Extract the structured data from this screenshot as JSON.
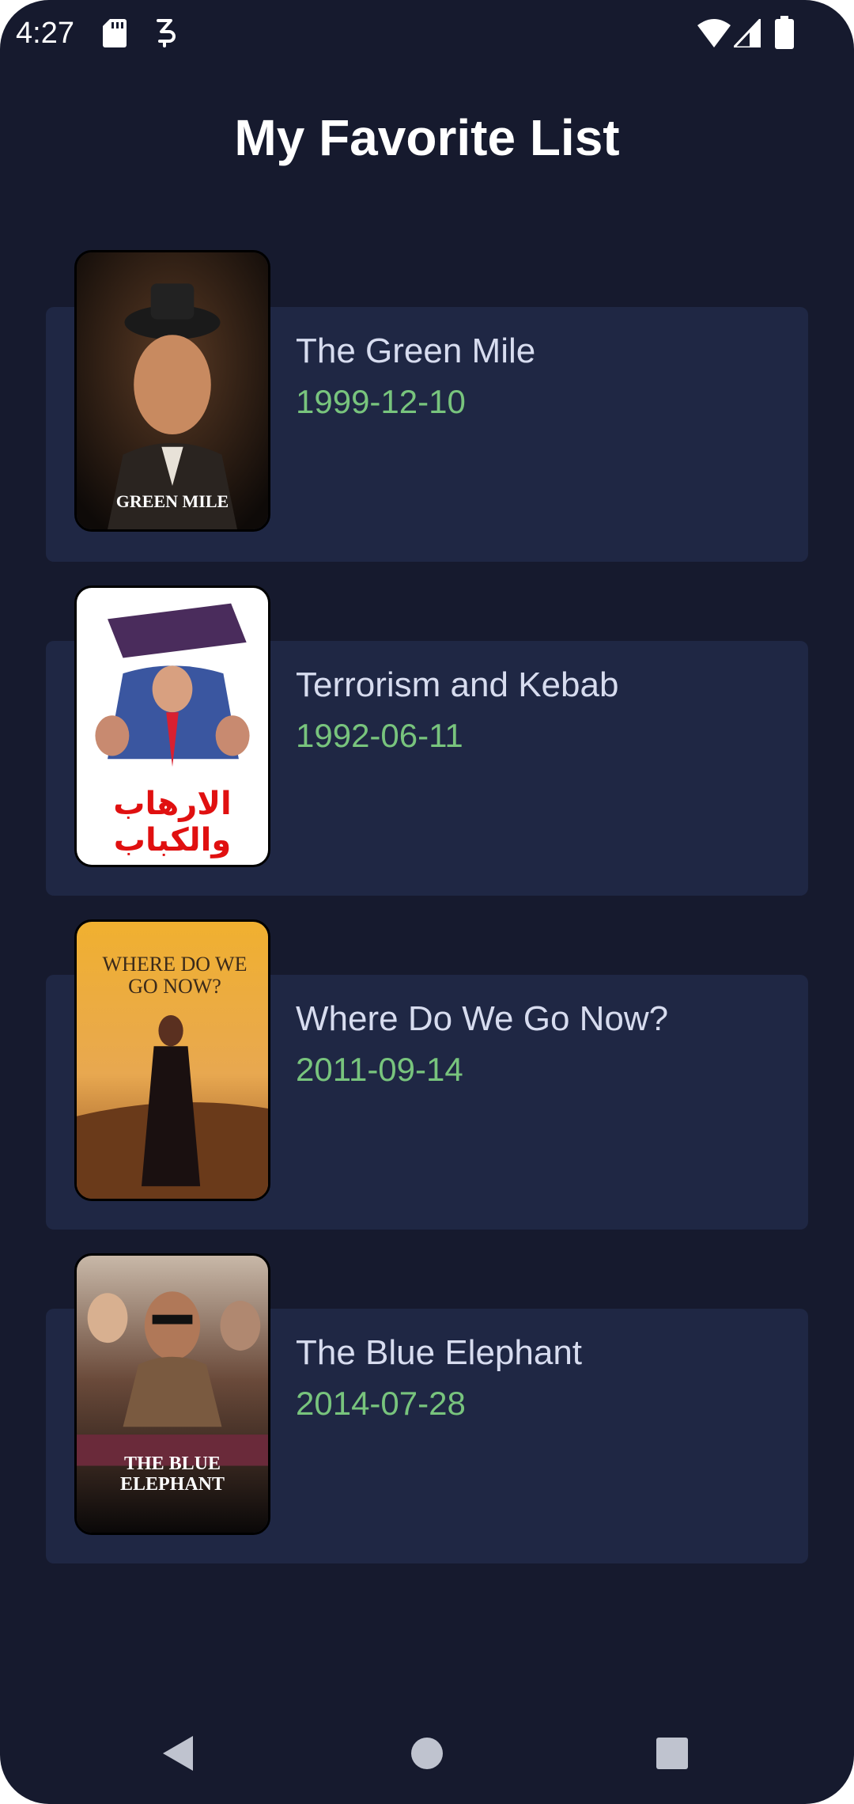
{
  "status_bar": {
    "time": "4:27",
    "icons": [
      "sd-card-icon",
      "sim-icon",
      "wifi-icon",
      "signal-icon",
      "battery-icon"
    ]
  },
  "header": {
    "title": "My Favorite List"
  },
  "movies": [
    {
      "title": "The Green Mile",
      "date": "1999-12-10",
      "poster_text": "GREEN MILE"
    },
    {
      "title": "Terrorism and Kebab",
      "date": "1992-06-11",
      "poster_text": "الارهاب والكباب"
    },
    {
      "title": "Where Do We Go Now?",
      "date": "2011-09-14",
      "poster_text": "WHERE DO WE GO NOW?"
    },
    {
      "title": "The Blue Elephant",
      "date": "2014-07-28",
      "poster_text": "THE BLUE ELEPHANT"
    }
  ],
  "nav_bar": {
    "buttons": [
      "back-icon",
      "home-icon",
      "recents-icon"
    ]
  },
  "colors": {
    "background": "#161a2e",
    "card": "#1f2744",
    "title_text": "#d7dcef",
    "date_text": "#78c47d"
  }
}
